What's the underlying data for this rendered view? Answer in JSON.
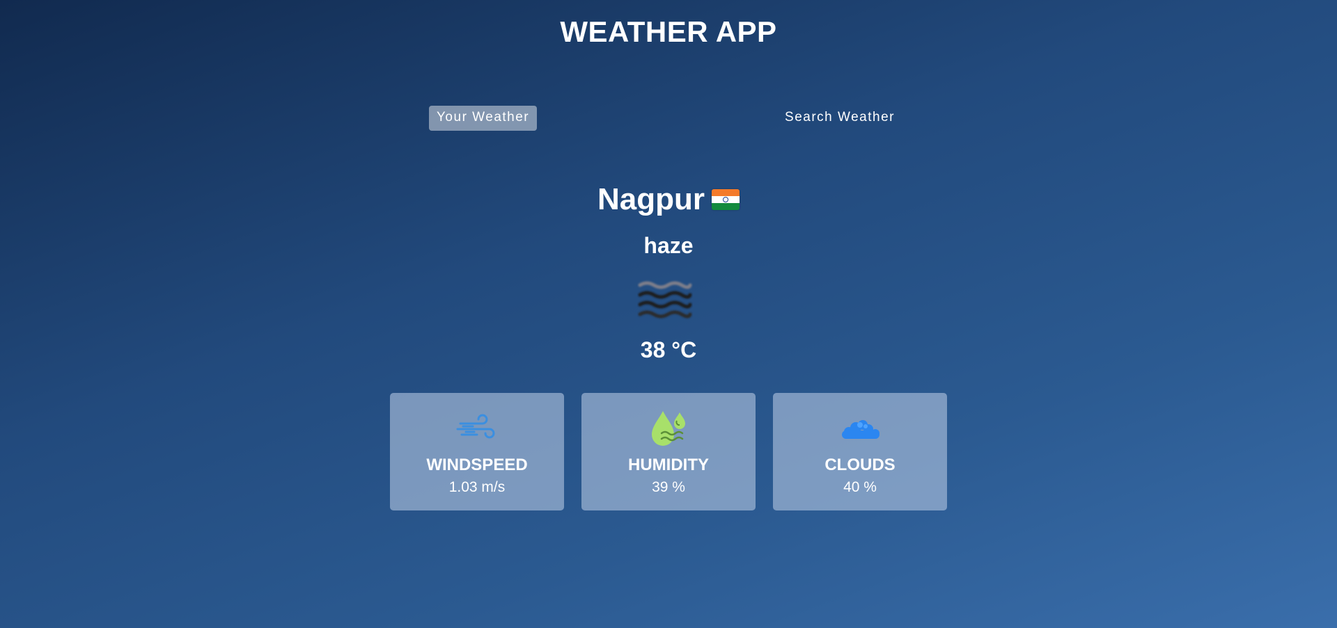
{
  "header": {
    "title": "WEATHER APP"
  },
  "tabs": [
    {
      "label": "Your Weather",
      "active": true
    },
    {
      "label": "Search Weather",
      "active": false
    }
  ],
  "weather": {
    "city": "Nagpur",
    "country_flag_icon": "india-flag-icon",
    "description": "haze",
    "condition_icon": "haze-icon",
    "temperature": "38 °C"
  },
  "stats": [
    {
      "label": "WINDSPEED",
      "value": "1.03 m/s",
      "icon": "wind-icon"
    },
    {
      "label": "HUMIDITY",
      "value": "39 %",
      "icon": "humidity-drop-icon"
    },
    {
      "label": "CLOUDS",
      "value": "40 %",
      "icon": "cloud-icon"
    }
  ],
  "colors": {
    "background_top": "#112a4f",
    "background_bottom": "#3a6eab",
    "card_bg": "#b0c4de",
    "wind_icon": "#3b8fe0",
    "humidity_icon": "#a8e06a",
    "cloud_icon": "#2b86f0"
  }
}
